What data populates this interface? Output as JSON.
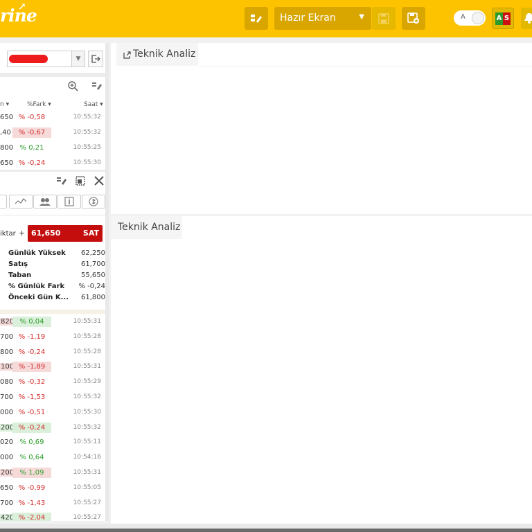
{
  "header": {
    "logo_text": "rine",
    "screen_select": {
      "selected": "Hazır Ekran"
    },
    "toggle_label": "A",
    "as_badge": {
      "a": "A",
      "s": "S"
    }
  },
  "watchlist1": {
    "headers": {
      "col1": "n",
      "col2": "%Fark",
      "col3": "Saat"
    },
    "rows": [
      {
        "price": "650",
        "change": "% -0,58",
        "time": "10:55:32"
      },
      {
        "price": ",40",
        "change": "% -0,67",
        "time": "10:55:32"
      },
      {
        "price": "800",
        "change": "% 0,21",
        "time": "10:55:25"
      },
      {
        "price": "650",
        "change": "% -0,24",
        "time": "10:55:30"
      }
    ]
  },
  "order": {
    "qty_label": "iktar",
    "plus": "+",
    "price": "61,650",
    "sell_label": "SAT"
  },
  "details": [
    {
      "key": "Günlük Yüksek",
      "value": "62,250"
    },
    {
      "key": "Satış",
      "value": "61,700"
    },
    {
      "key": "Taban",
      "value": "55,650"
    },
    {
      "key": "% Günlük Fark",
      "value": "% -0,24"
    },
    {
      "key": "Önceki Gün K...",
      "value": "61,800"
    }
  ],
  "watchlist2": {
    "rows": [
      {
        "price": "820",
        "change": "% 0,04",
        "time": "10:55:31"
      },
      {
        "price": "700",
        "change": "% -1,19",
        "time": "10:55:28"
      },
      {
        "price": "800",
        "change": "% -0,24",
        "time": "10:55:28"
      },
      {
        "price": "100",
        "change": "% -1,89",
        "time": "10:55:31"
      },
      {
        "price": "080",
        "change": "% -0,32",
        "time": "10:55:29"
      },
      {
        "price": "700",
        "change": "% -1,53",
        "time": "10:55:32"
      },
      {
        "price": "000",
        "change": "% -0,51",
        "time": "10:55:30"
      },
      {
        "price": "200",
        "change": "% -0,24",
        "time": "10:55:32"
      },
      {
        "price": "020",
        "change": "% 0,69",
        "time": "10:55:11"
      },
      {
        "price": "000",
        "change": "% 0,64",
        "time": "10:54:16"
      },
      {
        "price": "200",
        "change": "% 1,09",
        "time": "10:55:31"
      },
      {
        "price": "650",
        "change": "% -0,99",
        "time": "10:55:05"
      },
      {
        "price": "700",
        "change": "% -1,43",
        "time": "10:55:27"
      },
      {
        "price": "420",
        "change": "% -2,04",
        "time": "10:55:27"
      }
    ]
  },
  "panels": {
    "top_tab": "Teknik Analiz",
    "bottom_tab": "Teknik Analiz"
  },
  "colors": {
    "brand": "#fdc300",
    "sell": "#c40d0d",
    "negative": "#d62b2b",
    "positive": "#2a9d2a"
  }
}
